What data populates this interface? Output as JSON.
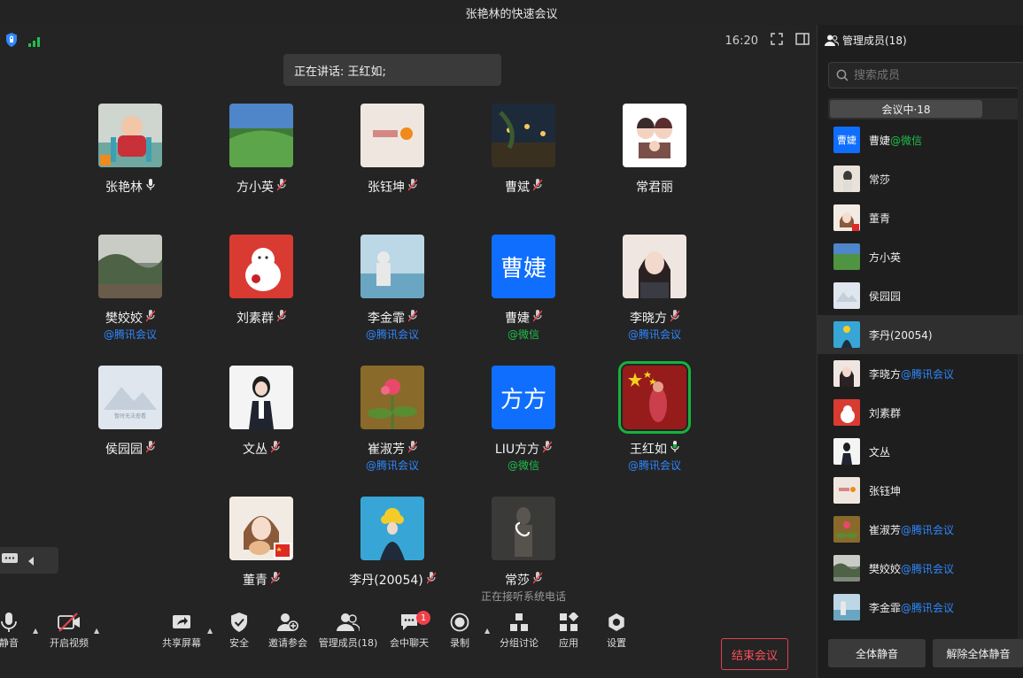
{
  "window": {
    "title": "张艳林的快速会议"
  },
  "status": {
    "time": "16:20"
  },
  "speaking": {
    "text": "正在讲话: 王红如;"
  },
  "participants": [
    {
      "name": "张艳林",
      "source": "",
      "note": ""
    },
    {
      "name": "方小英",
      "source": "",
      "note": ""
    },
    {
      "name": "张钰坤",
      "source": "",
      "note": ""
    },
    {
      "name": "曹斌",
      "source": "",
      "note": ""
    },
    {
      "name": "常君丽",
      "source": "",
      "note": ""
    },
    {
      "name": "樊姣姣",
      "source": "@腾讯会议",
      "note": ""
    },
    {
      "name": "刘素群",
      "source": "",
      "note": ""
    },
    {
      "name": "李金霏",
      "source": "@腾讯会议",
      "note": ""
    },
    {
      "name": "曹婕",
      "source": "@微信",
      "note": "",
      "avatar_text": "曹婕"
    },
    {
      "name": "李晓方",
      "source": "@腾讯会议",
      "note": ""
    },
    {
      "name": "侯园园",
      "source": "",
      "note": "",
      "avatar_text": "暂时无法查看"
    },
    {
      "name": "文丛",
      "source": "",
      "note": ""
    },
    {
      "name": "崔淑芳",
      "source": "@腾讯会议",
      "note": ""
    },
    {
      "name": "LIU方方",
      "source": "@微信",
      "note": "",
      "avatar_text": "方方"
    },
    {
      "name": "王红如",
      "source": "@腾讯会议",
      "note": ""
    },
    {
      "name": "董青",
      "source": "",
      "note": ""
    },
    {
      "name": "李丹(20054)",
      "source": "",
      "note": ""
    },
    {
      "name": "常莎",
      "source": "",
      "note": "正在接听系统电话"
    }
  ],
  "toolbar": {
    "mute": "静音",
    "video": "开启视频",
    "share": "共享屏幕",
    "security": "安全",
    "invite": "邀请参会",
    "members": "管理成员(18)",
    "chat": "会中聊天",
    "chat_badge": "1",
    "record": "录制",
    "breakout": "分组讨论",
    "apps": "应用",
    "settings": "设置",
    "end": "结束会议"
  },
  "sidebar": {
    "header": "管理成员(18)",
    "search_placeholder": "搜索成员",
    "tab": "会议中·18",
    "members": [
      {
        "name": "曹婕",
        "source": "@微信",
        "avatar_text": "曹婕"
      },
      {
        "name": "常莎",
        "source": ""
      },
      {
        "name": "董青",
        "source": ""
      },
      {
        "name": "方小英",
        "source": ""
      },
      {
        "name": "侯园园",
        "source": ""
      },
      {
        "name": "李丹(20054)",
        "source": ""
      },
      {
        "name": "李晓方",
        "source": "@腾讯会议"
      },
      {
        "name": "刘素群",
        "source": ""
      },
      {
        "name": "文丛",
        "source": ""
      },
      {
        "name": "张钰坤",
        "source": ""
      },
      {
        "name": "崔淑芳",
        "source": "@腾讯会议"
      },
      {
        "name": "樊姣姣",
        "source": "@腾讯会议"
      },
      {
        "name": "李金霏",
        "source": "@腾讯会议"
      }
    ],
    "mute_all": "全体静音",
    "unmute_all": "解除全体静音"
  },
  "colors": {
    "accent": "#0f6efd",
    "tencent": "#2f87ff",
    "wechat": "#1fbf4c",
    "end": "#ff4e5a",
    "speaking": "#16b23e"
  }
}
